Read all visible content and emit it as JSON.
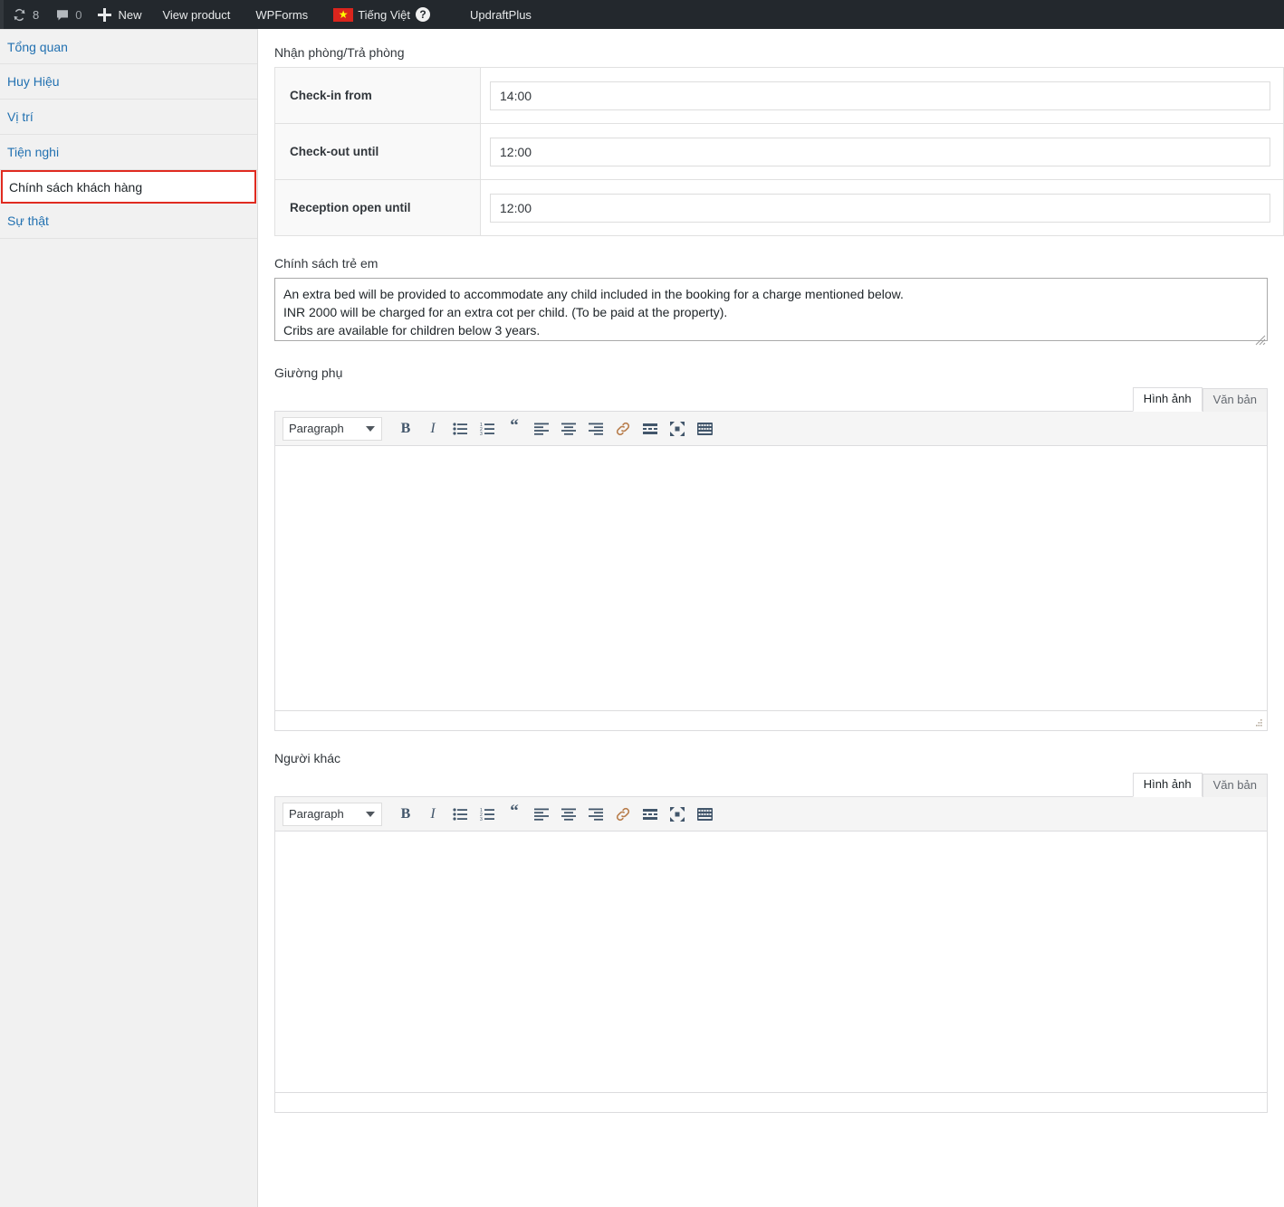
{
  "adminbar": {
    "update_icon": "update-icon",
    "update_count": "8",
    "comment_icon": "comment-icon",
    "comment_count": "0",
    "new_icon": "plus-icon",
    "new_label": "New",
    "view_product_label": "View product",
    "wpforms_label": "WPForms",
    "language_label": "Tiếng Việt",
    "help_label": "?",
    "updraftplus_label": "UpdraftPlus"
  },
  "sidebar": {
    "items": [
      {
        "label": "Tổng quan",
        "active": false
      },
      {
        "label": "Huy Hiệu",
        "active": false
      },
      {
        "label": "Vị trí",
        "active": false
      },
      {
        "label": "Tiện nghi",
        "active": false
      },
      {
        "label": "Chính sách khách hàng",
        "active": true
      },
      {
        "label": "Sự thật",
        "active": false
      }
    ]
  },
  "main": {
    "checkin_section": {
      "title": "Nhận phòng/Trả phòng",
      "rows": [
        {
          "label": "Check-in from",
          "value": "14:00"
        },
        {
          "label": "Check-out until",
          "value": "12:00"
        },
        {
          "label": "Reception open until",
          "value": "12:00"
        }
      ]
    },
    "children_section": {
      "title": "Chính sách trẻ em",
      "value": "An extra bed will be provided to accommodate any child included in the booking for a charge mentioned below.\nINR 2000 will be charged for an extra cot per child. (To be paid at the property).\nCribs are available for children below 3 years."
    },
    "extra_bed_section": {
      "title": "Giường phụ",
      "tab_visual": "Hình ảnh",
      "tab_text": "Văn bản",
      "content": ""
    },
    "other_people_section": {
      "title": "Người khác",
      "tab_visual": "Hình ảnh",
      "tab_text": "Văn bản",
      "content": ""
    },
    "toolbar": {
      "format_select": "Paragraph",
      "buttons": [
        {
          "name": "bold-icon",
          "label": "B"
        },
        {
          "name": "italic-icon",
          "label": "I"
        },
        {
          "name": "bulleted-list-icon",
          "label": ""
        },
        {
          "name": "numbered-list-icon",
          "label": ""
        },
        {
          "name": "blockquote-icon",
          "label": "“"
        },
        {
          "name": "align-left-icon",
          "label": ""
        },
        {
          "name": "align-center-icon",
          "label": ""
        },
        {
          "name": "align-right-icon",
          "label": ""
        },
        {
          "name": "link-icon",
          "label": ""
        },
        {
          "name": "read-more-icon",
          "label": ""
        },
        {
          "name": "fullscreen-icon",
          "label": ""
        },
        {
          "name": "toolbar-toggle-icon",
          "label": ""
        }
      ]
    }
  },
  "colors": {
    "adminbar_bg": "#23282d",
    "sidebar_bg": "#f1f1f1",
    "link": "#2271b1",
    "highlight_border": "#e02b20",
    "flag_red": "#da251d",
    "flag_star": "#ffff00"
  }
}
